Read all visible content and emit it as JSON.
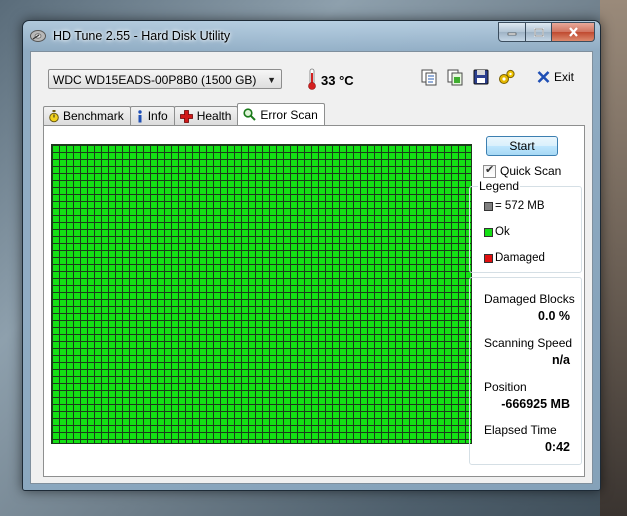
{
  "window": {
    "title": "HD Tune 2.55 - Hard Disk Utility"
  },
  "drive": {
    "selected": "WDC WD15EADS-00P8B0 (1500 GB)"
  },
  "temperature": "33 °C",
  "exit_label": "Exit",
  "tabs": [
    {
      "label": "Benchmark",
      "icon": "stopwatch-icon"
    },
    {
      "label": "Info",
      "icon": "info-icon"
    },
    {
      "label": "Health",
      "icon": "health-cross-icon"
    },
    {
      "label": "Error Scan",
      "icon": "magnifier-icon",
      "active": true
    }
  ],
  "scan": {
    "start_label": "Start",
    "quick_scan_label": "Quick Scan",
    "quick_scan_checked": true
  },
  "legend": {
    "title": "Legend",
    "block_size": "= 572 MB",
    "ok": "Ok",
    "damaged": "Damaged",
    "colors": {
      "block": "#808080",
      "ok": "#14e014",
      "damaged": "#e01010"
    }
  },
  "stats": {
    "damaged_blocks_label": "Damaged Blocks",
    "damaged_blocks_value": "0.0 %",
    "scanning_speed_label": "Scanning Speed",
    "scanning_speed_value": "n/a",
    "position_label": "Position",
    "position_value": "-666925 MB",
    "elapsed_label": "Elapsed Time",
    "elapsed_value": "0:42"
  }
}
